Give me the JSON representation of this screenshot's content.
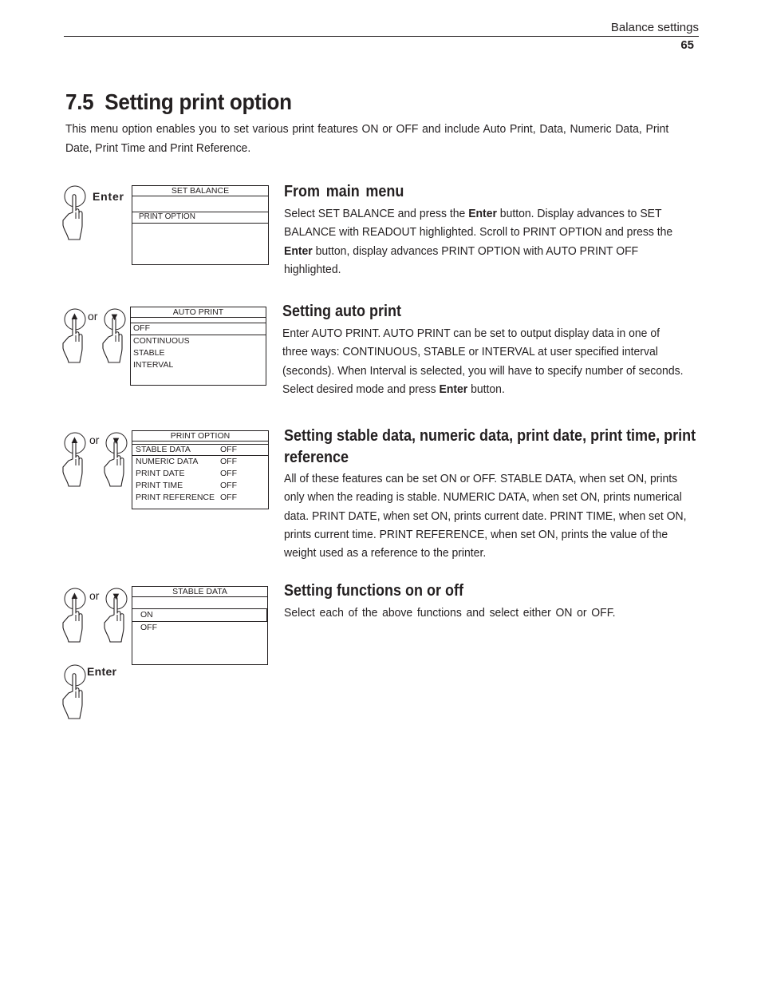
{
  "header": {
    "section": "Balance settings",
    "page_number": "65"
  },
  "title": "7.5  Setting print option",
  "intro": "This menu option enables you to set various print features ON or OFF and include Auto Print, Data, Numeric Data, Print Date, Print Time and Print Reference.",
  "labels": {
    "enter": "Enter",
    "or": "or"
  },
  "icons": {
    "enter_button": "hand-pressing-enter-button",
    "up_button": "hand-pressing-up-arrow-button",
    "down_button": "hand-pressing-down-arrow-button",
    "up_glyph": "▲",
    "down_glyph": "▼"
  },
  "sections": [
    {
      "heading": "From main menu",
      "body_parts": [
        "Select SET BALANCE and press the ",
        "Enter",
        " button. Display advances to SET BALANCE with READOUT highlighted. Scroll to PRINT OPTION and press the ",
        "Enter",
        " button, display advances PRINT OPTION with AUTO PRINT OFF highlighted."
      ],
      "display": {
        "title": "SET  BALANCE",
        "rows": [
          "",
          "PRINT  OPTION"
        ],
        "selected_index": 1
      }
    },
    {
      "heading": "Setting auto print",
      "body_parts": [
        "Enter AUTO PRINT. AUTO PRINT can be set to output display data in one of three ways: CONTINUOUS, STABLE or INTERVAL at user specified interval (seconds). When Interval is selected, you will have to specify number of seconds. Select desired mode and press ",
        "Enter",
        " button."
      ],
      "display": {
        "title": "AUTO PRINT",
        "rows": [
          "OFF",
          "CONTINUOUS",
          "STABLE",
          "INTERVAL"
        ],
        "selected_index": 0
      }
    },
    {
      "heading": "Setting stable data, numeric data, print date, print time, print reference",
      "body": "All of these features can be set ON or OFF. STABLE DATA, when set ON, prints only when the reading is stable. NUMERIC DATA, when set ON, prints numerical data. PRINT DATE, when set ON, prints current date. PRINT TIME, when set ON, prints current time. PRINT REFERENCE, when set ON, prints the value of the weight used as a reference to the printer.",
      "display": {
        "title": "PRINT OPTION",
        "rows": [
          {
            "name": "STABLE DATA",
            "value": "OFF"
          },
          {
            "name": "NUMERIC DATA",
            "value": "OFF"
          },
          {
            "name": "PRINT DATE",
            "value": "OFF"
          },
          {
            "name": "PRINT TIME",
            "value": "OFF"
          },
          {
            "name": "PRINT REFERENCE",
            "value": "OFF"
          }
        ],
        "selected_index": 0
      }
    },
    {
      "heading": "Setting functions on or off",
      "body": "Select each of the above functions and select either ON or OFF.",
      "display": {
        "title": "STABLE DATA",
        "rows": [
          "ON",
          "OFF"
        ],
        "selected_index": 0
      }
    }
  ]
}
